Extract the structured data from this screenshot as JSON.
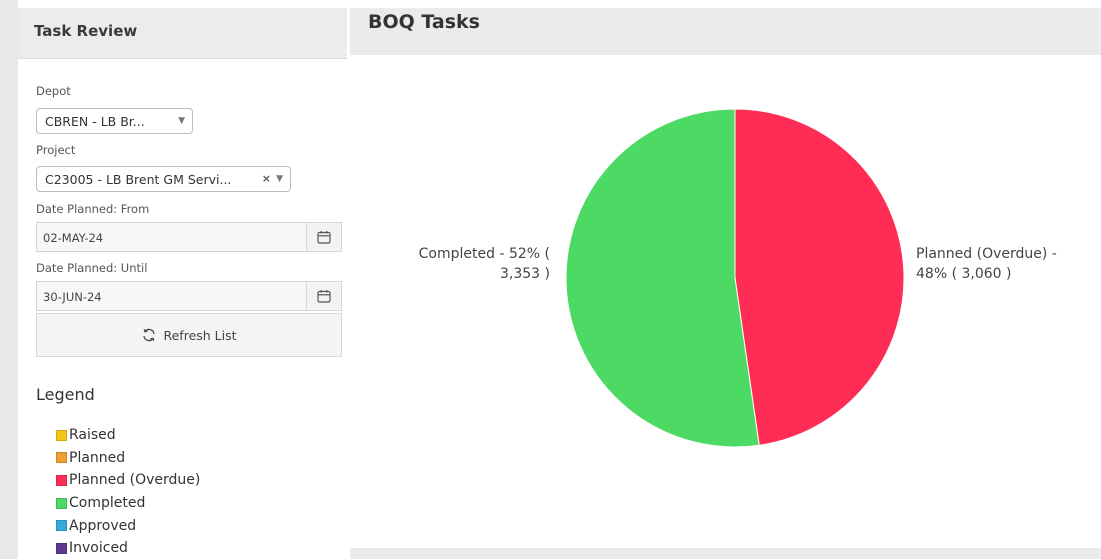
{
  "left_panel": {
    "title": "Task Review",
    "depot": {
      "label": "Depot",
      "value": "CBREN - LB Br..."
    },
    "project": {
      "label": "Project",
      "value": "C23005 - LB Brent GM Servi..."
    },
    "date_from": {
      "label": "Date Planned: From",
      "value": "02-MAY-24"
    },
    "date_until": {
      "label": "Date Planned: Until",
      "value": "30-JUN-24"
    },
    "refresh_label": "Refresh List",
    "legend": {
      "title": "Legend",
      "items": [
        {
          "label": "Raised",
          "color": "#f5c518"
        },
        {
          "label": "Planned",
          "color": "#f0a030"
        },
        {
          "label": "Planned (Overdue)",
          "color": "#ff2d55"
        },
        {
          "label": "Completed",
          "color": "#4cd964"
        },
        {
          "label": "Approved",
          "color": "#34aadc"
        },
        {
          "label": "Invoiced",
          "color": "#5e3a8c"
        }
      ]
    }
  },
  "chart_panel": {
    "title": "BOQ Tasks"
  },
  "chart_data": {
    "type": "pie",
    "title": "BOQ Tasks",
    "slices": [
      {
        "label": "Planned (Overdue)",
        "value": 3060,
        "percent": 48,
        "color": "#ff2d55",
        "label_lines": [
          "Planned (Overdue) -",
          "48% ( 3,060 )"
        ]
      },
      {
        "label": "Completed",
        "value": 3353,
        "percent": 52,
        "color": "#4cd964",
        "label_lines": [
          "Completed - 52% (",
          "3,353 )"
        ]
      }
    ]
  }
}
